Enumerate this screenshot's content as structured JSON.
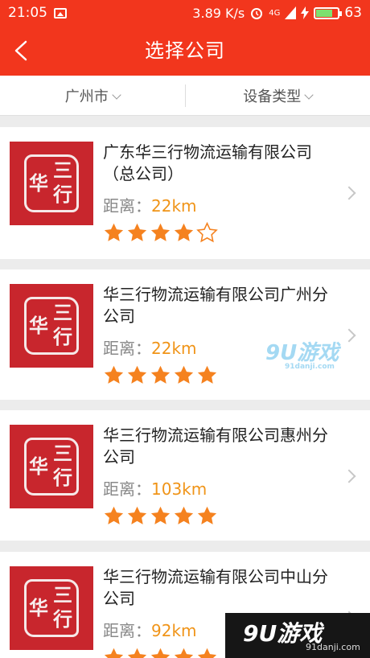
{
  "status_bar": {
    "time": "21:05",
    "speed": "3.89 K/s",
    "network": "4G",
    "battery": "63"
  },
  "header": {
    "title": "选择公司"
  },
  "filters": {
    "city": "广州市",
    "device_type": "设备类型"
  },
  "list_label": "距离：",
  "companies": [
    {
      "name": "广东华三行物流运输有限公司（总公司）",
      "distance": "22km",
      "rating": 4
    },
    {
      "name": "华三行物流运输有限公司广州分公司",
      "distance": "22km",
      "rating": 5
    },
    {
      "name": "华三行物流运输有限公司惠州分公司",
      "distance": "103km",
      "rating": 5
    },
    {
      "name": "华三行物流运输有限公司中山分公司",
      "distance": "92km",
      "rating": 5
    }
  ],
  "logo_text": [
    "华",
    "三",
    "行"
  ],
  "watermarks": {
    "center": "9U游戏",
    "center_url": "91danji.com",
    "corner": "9U游戏",
    "corner_url": "91danji.com"
  },
  "colors": {
    "accent": "#f2361d",
    "star": "#f5821f",
    "distance": "#f09418"
  }
}
